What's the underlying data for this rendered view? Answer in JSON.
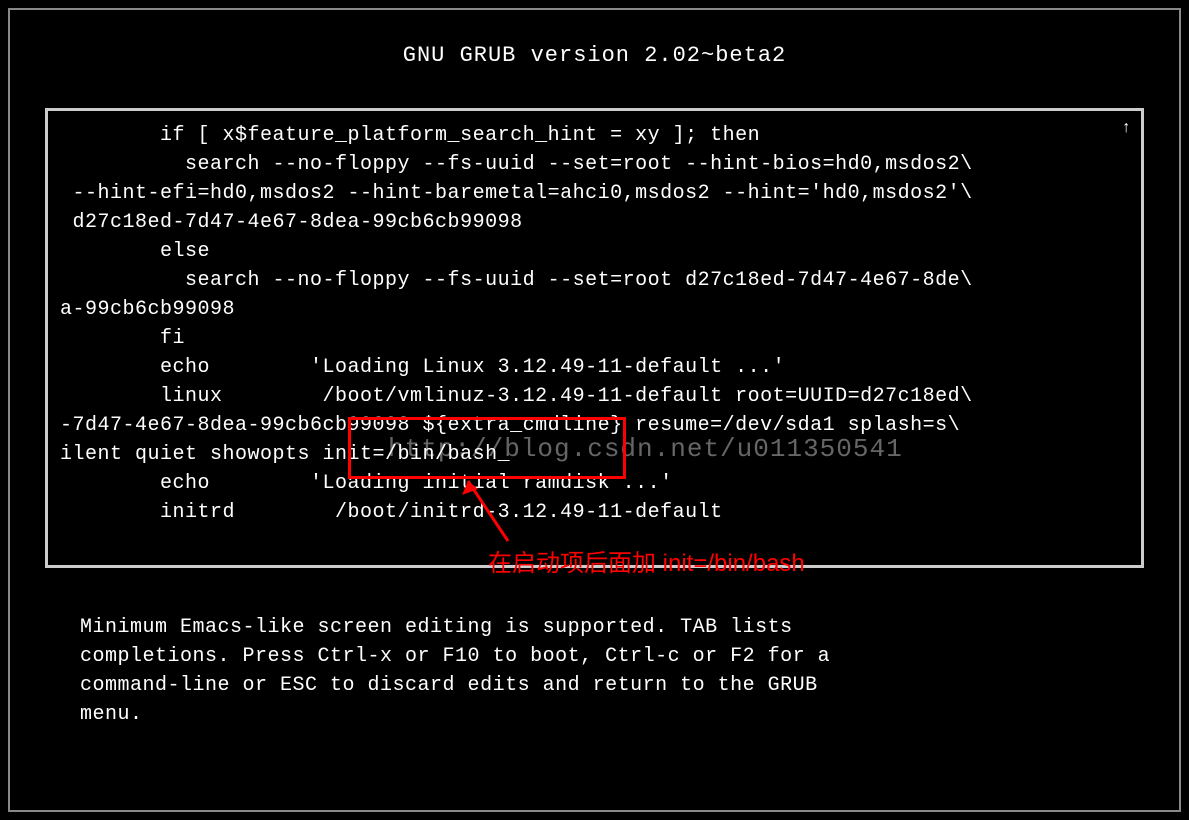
{
  "title": "GNU GRUB  version 2.02~beta2",
  "scroll_indicator": "↑",
  "code_lines": [
    "        if [ x$feature_platform_search_hint = xy ]; then",
    "          search --no-floppy --fs-uuid --set=root --hint-bios=hd0,msdos2\\",
    " --hint-efi=hd0,msdos2 --hint-baremetal=ahci0,msdos2 --hint='hd0,msdos2'\\",
    " d27c18ed-7d47-4e67-8dea-99cb6cb99098",
    "        else",
    "          search --no-floppy --fs-uuid --set=root d27c18ed-7d47-4e67-8de\\",
    "a-99cb6cb99098",
    "        fi",
    "        echo        'Loading Linux 3.12.49-11-default ...'",
    "        linux        /boot/vmlinuz-3.12.49-11-default root=UUID=d27c18ed\\",
    "-7d47-4e67-8dea-99cb6cb99098 ${extra_cmdline} resume=/dev/sda1 splash=s\\",
    "ilent quiet showopts init=/bin/bash_",
    "        echo        'Loading initial ramdisk ...'",
    "        initrd        /boot/initrd-3.12.49-11-default"
  ],
  "watermark": "http://blog.csdn.net/u011350541",
  "annotation_text": "在启动项后面加 init=/bin/bash",
  "help_text": "Minimum Emacs-like screen editing is supported. TAB lists\ncompletions. Press Ctrl-x or F10 to boot, Ctrl-c or F2 for a\ncommand-line or ESC to discard edits and return to the GRUB\nmenu."
}
